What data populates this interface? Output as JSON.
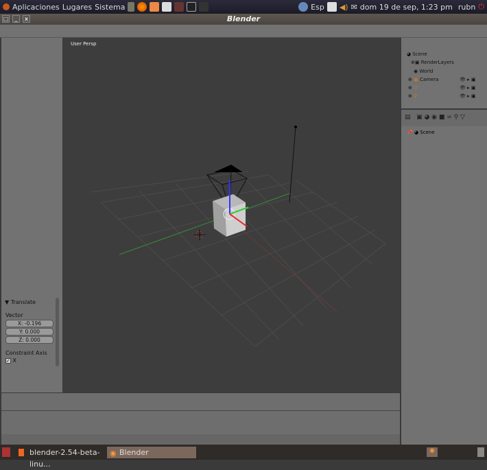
{
  "top_panel": {
    "menus": [
      "Aplicaciones",
      "Lugares",
      "Sistema"
    ],
    "keyboard": "Esp",
    "datetime": "dom 19 de sep,  1:23 pm",
    "user": "rubn"
  },
  "window": {
    "title": "Blender",
    "buttons": [
      "□",
      "_",
      "x"
    ]
  },
  "viewport": {
    "label": "User Persp"
  },
  "redo_panel": {
    "title": "Translate",
    "vector_label": "Vector",
    "x": "X: -0.196",
    "y": "Y: 0.000",
    "z": "Z: 0.000",
    "constraint_label": "Constraint Axis",
    "constraint_x": "X",
    "constraint_x_checked": true
  },
  "outliner": {
    "items": [
      "Scene",
      "RenderLayers",
      "World",
      "Camera"
    ]
  },
  "properties": {
    "context": "Scene"
  },
  "taskbar": {
    "items": [
      "blender-2.54-beta-linu...",
      "Blender"
    ]
  }
}
